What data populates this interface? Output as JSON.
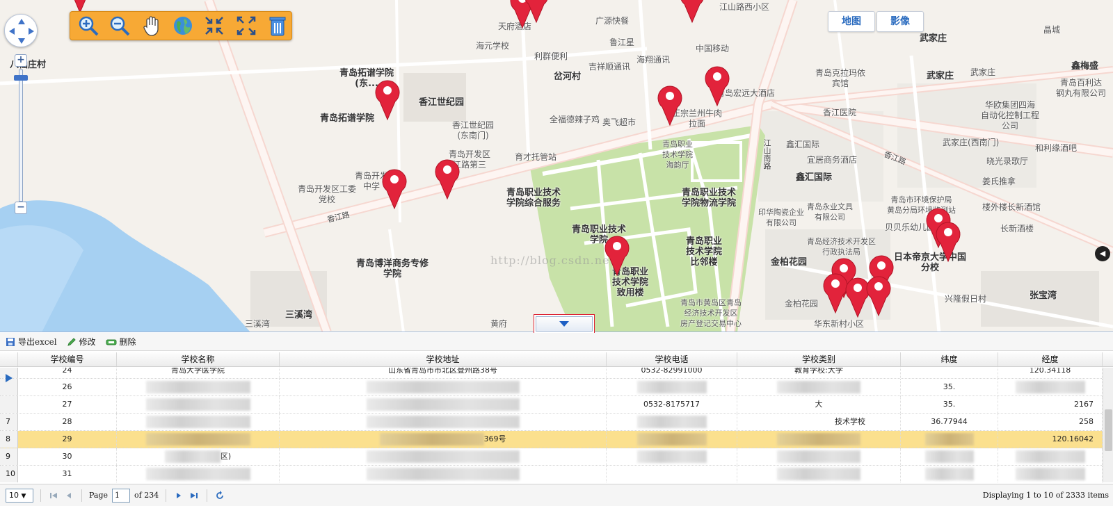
{
  "map": {
    "type_buttons": {
      "map": "地图",
      "satellite": "影像"
    },
    "watermark": "http://blog.csdn.net",
    "labels": {
      "qingdao_tuopu_east": "青岛拓谱学院\n(东...",
      "qingdao_tuopu": "青岛拓谱学院",
      "xiangjiang_shiji": "香江世纪园",
      "xiangjiang_shiji_gate": "香江世纪园\n(东南门)",
      "kaifaqu_third": "青岛开发区\n江路第三",
      "kaifaqu_committee": "青岛开发区工委\n党校",
      "yucai": "育才托管站",
      "boyang": "青岛博洋商务专修\n学院",
      "sanxiwan": "三溪湾",
      "sanxiwan2": "三溪湾",
      "xiangjiang_road": "香江路",
      "xiangjiang_road_e": "香江路",
      "jiangshan_road": "江山南路",
      "hekou_village": "岔河村",
      "zhiye_service": "青岛职业技术\n学院综合服务",
      "zhiye_logistics": "青岛职业技术\n学院物流学院",
      "zhiye_main": "青岛职业技术\n学院",
      "zhiye_bizhai": "青岛职业\n技术学院\n比邻楼",
      "zhiye_zhiyong": "青岛职业\n技术学院\n致用楼",
      "zhiye_haiyun": "青岛职业\n技术学院\n海韵厅",
      "huangdao_ec": "青岛市黄岛区青岛\n经济技术开发区\n房产登记交易中心",
      "wujiazhuang": "武家庄",
      "wujiazhuang2": "武家庄",
      "wujiazhuang3": "武家庄",
      "wujiazhuang_sw": "武家庄(西南门)",
      "xinhui": "鑫汇国际",
      "xinhui2": "鑫汇国际",
      "jinbai": "金柏花园",
      "jinbai2": "金柏花园",
      "riben": "日本帝京大学中国\n分校",
      "xinglong": "兴隆假日村",
      "zhangbaowan": "张宝湾",
      "yiwen": "印华陶瓷企业\n有限公司",
      "huanbao": "青岛市环境保护局\n黄岛分局环境监测站",
      "changxin": "长新酒楼",
      "beibei": "贝贝乐幼儿园",
      "xiangjiang_hosp": "香江医院",
      "chinamobile": "中国移动",
      "jiangshan_xi": "江山路西小区",
      "guangfu": "广源快餐",
      "tianfu": "天府酒店",
      "haiyuan": "海元学校",
      "huashan": "八仙庄村",
      "lanzhou": "正宗兰州牛肉\n拉面",
      "qingyuan": "青岛宏远大酒店",
      "jixiang": "吉祥顺通讯",
      "haixiang": "海翔通讯",
      "lixin": "利群便利",
      "jixiang_fire": "鲁江星",
      "quanfu": "全福德辣子鸡",
      "aofei": "奥飞超市",
      "hualou": "华欧集团四海\n自动化控制工程\n公司",
      "helisheng": "和利缘酒吧",
      "xiaoguang": "晓光录歌厅",
      "jiangsheng": "姜氏推拿",
      "louwai": "楼外楼长新酒馆",
      "yongye": "青岛永业文具\n有限公司",
      "yishang": "宜居商务酒店",
      "kaifa_exec": "青岛经济技术开发区\n行政执法局",
      "jiao": "晶城",
      "xinmeihe": "鑫梅盛",
      "baili": "青岛百利达\n钢丸有限公司",
      "qingdao_kela": "青岛克拉玛依\n宾馆",
      "kaifaqu_middle": "青岛开发\n中学",
      "huangdao_sub": "华东新村小区",
      "huangfu": "黄府"
    }
  },
  "grid": {
    "toolbar": {
      "export": "导出excel",
      "edit": "修改",
      "delete": "删除"
    },
    "columns": [
      "学校编号",
      "学校名称",
      "学校地址",
      "学校电话",
      "学校类别",
      "纬度",
      "经度"
    ],
    "rows": [
      {
        "rn": "",
        "id": "24",
        "name": "青岛大学医学院",
        "addr": "山东省青岛市市北区登州路38号",
        "phone": "0532-82991000",
        "type": "教育学校:大学",
        "lat": "",
        "lng": "120.34118"
      },
      {
        "rn": "",
        "id": "26",
        "name": "",
        "addr": "",
        "phone": "",
        "type": "",
        "lat": "35.",
        "lng": ""
      },
      {
        "rn": "",
        "id": "27",
        "name": "",
        "addr": "",
        "phone": "0532-8175717",
        "type": "大",
        "lat": "35.",
        "lng": "2167"
      },
      {
        "rn": "7",
        "id": "28",
        "name": "",
        "addr": "",
        "phone": "",
        "type": "技术学校",
        "lat": "36.77944",
        "lng": "258"
      },
      {
        "rn": "8",
        "id": "29",
        "name": "",
        "addr": "369号",
        "phone": "",
        "type": "",
        "lat": "",
        "lng": "120.16042"
      },
      {
        "rn": "9",
        "id": "30",
        "name": "区)",
        "addr": "",
        "phone": "",
        "type": "",
        "lat": "",
        "lng": ""
      },
      {
        "rn": "10",
        "id": "31",
        "name": "",
        "addr": "",
        "phone": "",
        "type": "",
        "lat": "",
        "lng": ""
      }
    ]
  },
  "pager": {
    "page_size": "10",
    "page_label": "Page",
    "page_value": "1",
    "of_label": "of 234",
    "info": "Displaying 1 to 10 of 2333 items"
  }
}
